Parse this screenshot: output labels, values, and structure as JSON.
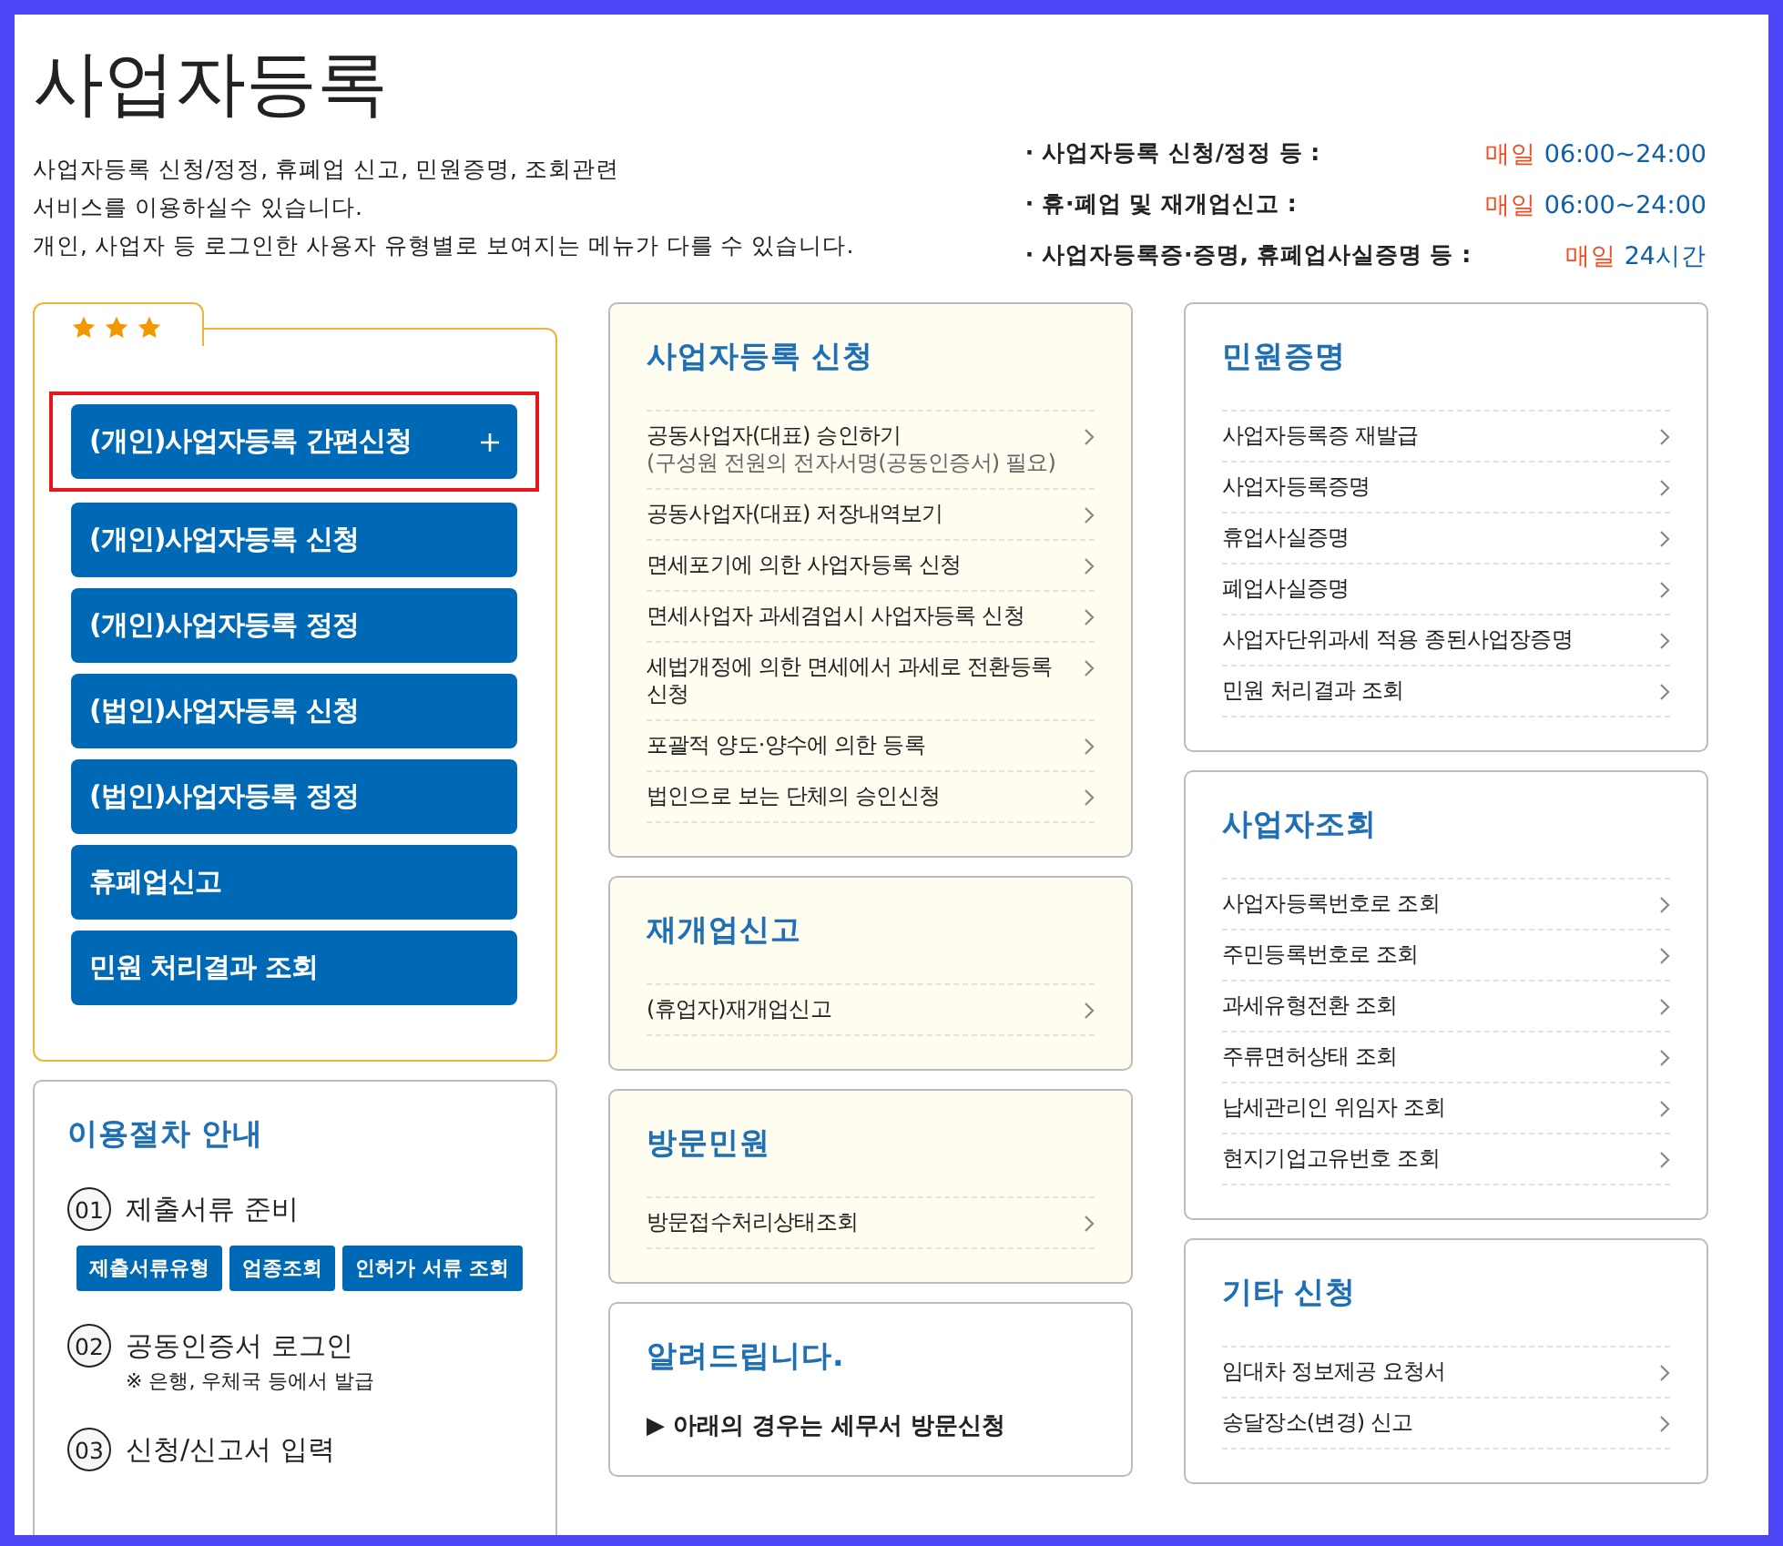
{
  "header": {
    "title": "사업자등록",
    "description": [
      "사업자등록 신청/정정, 휴폐업 신고, 민원증명, 조회관련",
      "서비스를 이용하실수 있습니다.",
      "개인, 사업자 등 로그인한 사용자 유형별로 보여지는 메뉴가 다를 수 있습니다."
    ],
    "hours": [
      {
        "label": "· 사업자등록 신청/정정 등 :",
        "day": "매일",
        "time": "06:00~24:00"
      },
      {
        "label": "· 휴·폐업 및 재개업신고 :",
        "day": "매일",
        "time": "06:00~24:00"
      },
      {
        "label": "· 사업자등록증·증명, 휴폐업사실증명 등 :",
        "day": "매일",
        "time": "24시간"
      }
    ]
  },
  "quick_menu": {
    "buttons": [
      {
        "label": "(개인)사업자등록 간편신청",
        "highlighted": true
      },
      {
        "label": "(개인)사업자등록 신청",
        "highlighted": false
      },
      {
        "label": "(개인)사업자등록 정정",
        "highlighted": false
      },
      {
        "label": "(법인)사업자등록 신청",
        "highlighted": false
      },
      {
        "label": "(법인)사업자등록 정정",
        "highlighted": false
      },
      {
        "label": "휴폐업신고",
        "highlighted": false
      },
      {
        "label": "민원 처리결과 조회",
        "highlighted": false
      }
    ]
  },
  "procedure": {
    "title": "이용절차 안내",
    "steps": [
      {
        "number": "01",
        "label": "제출서류 준비",
        "buttons": [
          "제출서류유형",
          "업종조회",
          "인허가 서류 조회"
        ]
      },
      {
        "number": "02",
        "label": "공동인증서 로그인",
        "note": "※ 은행, 우체국 등에서 발급"
      },
      {
        "number": "03",
        "label": "신청/신고서 입력"
      }
    ]
  },
  "columns": [
    [
      {
        "title": "사업자등록 신청",
        "kind": "tinted",
        "items": [
          {
            "label": "공동사업자(대표) 승인하기",
            "sub": "(구성원 전원의 전자서명(공동인증서) 필요)"
          },
          {
            "label": "공동사업자(대표) 저장내역보기"
          },
          {
            "label": "면세포기에 의한 사업자등록 신청"
          },
          {
            "label": "면세사업자 과세겸업시 사업자등록 신청"
          },
          {
            "label": "세법개정에 의한 면세에서 과세로 전환등록 신청"
          },
          {
            "label": "포괄적 양도·양수에 의한 등록"
          },
          {
            "label": "법인으로 보는 단체의 승인신청"
          }
        ]
      },
      {
        "title": "재개업신고",
        "kind": "tinted",
        "items": [
          {
            "label": "(휴업자)재개업신고"
          }
        ]
      },
      {
        "title": "방문민원",
        "kind": "tinted",
        "items": [
          {
            "label": "방문접수처리상태조회"
          }
        ]
      },
      {
        "title": "알려드립니다.",
        "kind": "plain",
        "notice": "▶ 아래의 경우는 세무서 방문신청"
      }
    ],
    [
      {
        "title": "민원증명",
        "kind": "plain",
        "items": [
          {
            "label": "사업자등록증 재발급"
          },
          {
            "label": "사업자등록증명"
          },
          {
            "label": "휴업사실증명"
          },
          {
            "label": "폐업사실증명"
          },
          {
            "label": "사업자단위과세 적용 종된사업장증명"
          },
          {
            "label": "민원 처리결과 조회"
          }
        ]
      },
      {
        "title": "사업자조회",
        "kind": "plain",
        "items": [
          {
            "label": "사업자등록번호로 조회"
          },
          {
            "label": "주민등록번호로 조회"
          },
          {
            "label": "과세유형전환 조회"
          },
          {
            "label": "주류면허상태 조회"
          },
          {
            "label": "납세관리인 위임자 조회"
          },
          {
            "label": "현지기업고유번호 조회"
          }
        ]
      },
      {
        "title": "기타 신청",
        "kind": "plain",
        "items": [
          {
            "label": "임대차 정보제공 요청서"
          },
          {
            "label": "송달장소(변경) 신고"
          }
        ]
      }
    ]
  ]
}
